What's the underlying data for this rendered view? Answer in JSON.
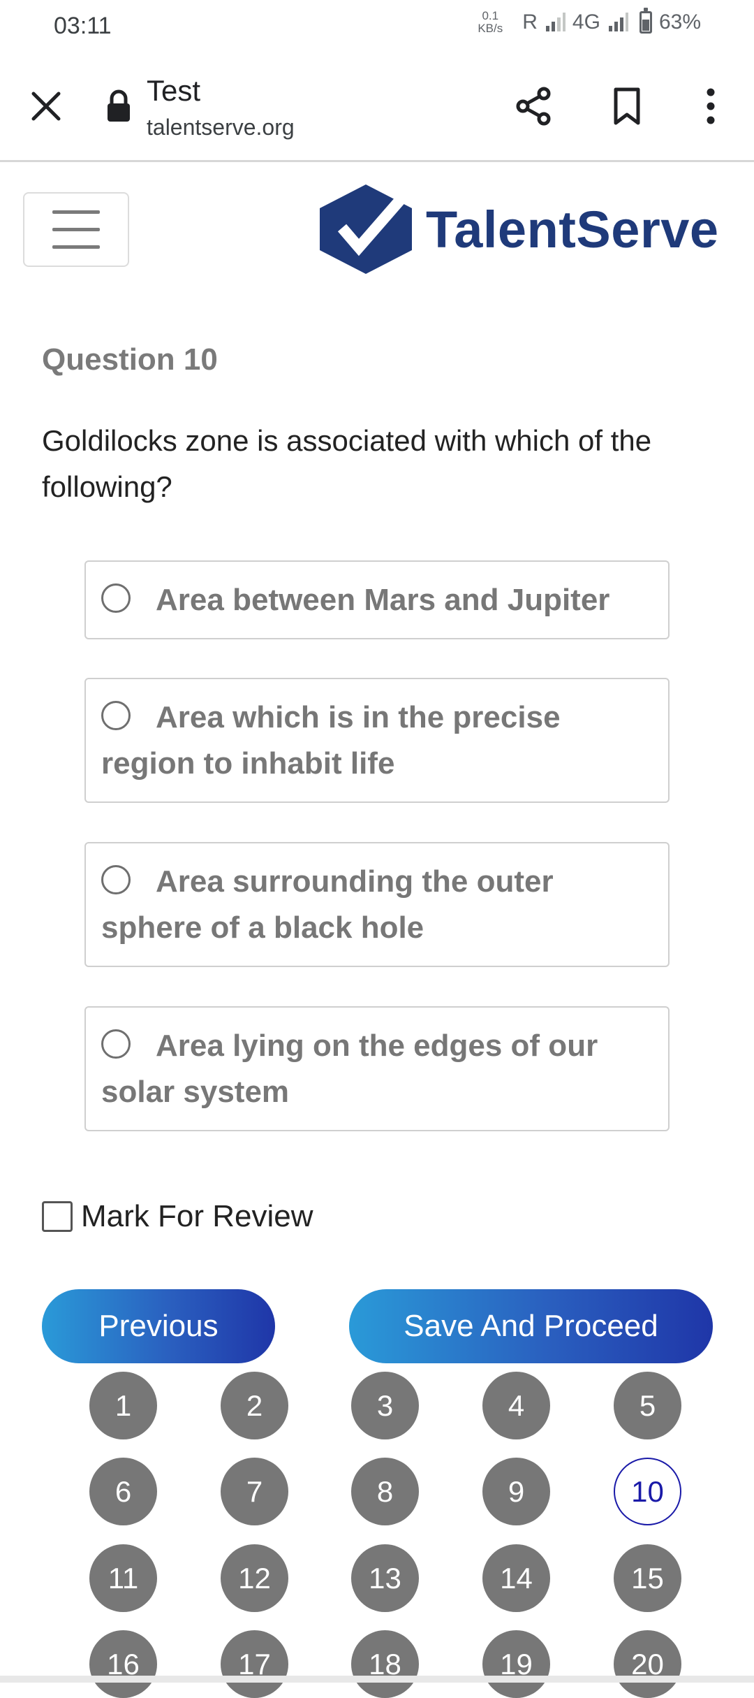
{
  "status_bar": {
    "time": "03:11",
    "net_speed_value": "0.1",
    "net_speed_unit": "KB/s",
    "roaming": "R",
    "network_type": "4G",
    "battery": "63%"
  },
  "browser": {
    "page_title": "Test",
    "url": "talentserve.org",
    "icons": [
      "close-icon",
      "lock-icon",
      "share-icon",
      "bookmark-icon",
      "more-vert-icon"
    ]
  },
  "site": {
    "logo_text": "TalentServe",
    "menu_icon": "hamburger-icon",
    "brand_color": "#1f3a7a"
  },
  "question": {
    "number_label": "Question 10",
    "text": "Goldilocks zone is associated with which of the following?",
    "options": [
      {
        "label": "Area between Mars and Jupiter"
      },
      {
        "label": "Area which is in the precise region to inhabit life"
      },
      {
        "label": "Area surrounding the outer sphere of a black hole"
      },
      {
        "label": "Area lying on the edges of our solar system"
      }
    ]
  },
  "review": {
    "label": "Mark For Review",
    "checked": false
  },
  "navigation": {
    "previous_label": "Previous",
    "next_label": "Save And Proceed",
    "button_gradient": [
      "#2a9ad8",
      "#1f36a8"
    ]
  },
  "palette": {
    "current": "10",
    "items": [
      "1",
      "2",
      "3",
      "4",
      "5",
      "6",
      "7",
      "8",
      "9",
      "10",
      "11",
      "12",
      "13",
      "14",
      "15",
      "16",
      "17",
      "18",
      "19",
      "20"
    ],
    "default_color": "#777777",
    "current_color": "#1a1aa8"
  }
}
